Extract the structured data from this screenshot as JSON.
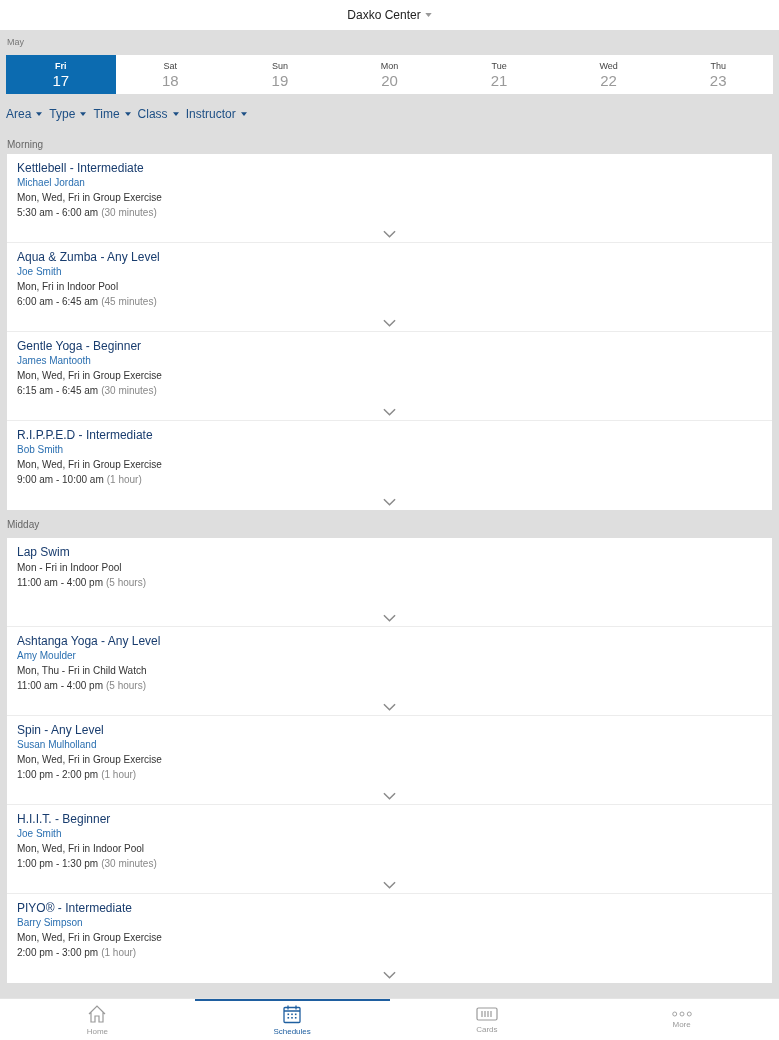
{
  "header": {
    "title": "Daxko Center"
  },
  "month": "May",
  "days": [
    {
      "weekday": "Fri",
      "date": "17",
      "selected": true
    },
    {
      "weekday": "Sat",
      "date": "18",
      "selected": false
    },
    {
      "weekday": "Sun",
      "date": "19",
      "selected": false
    },
    {
      "weekday": "Mon",
      "date": "20",
      "selected": false
    },
    {
      "weekday": "Tue",
      "date": "21",
      "selected": false
    },
    {
      "weekday": "Wed",
      "date": "22",
      "selected": false
    },
    {
      "weekday": "Thu",
      "date": "23",
      "selected": false
    }
  ],
  "filters": [
    "Area",
    "Type",
    "Time",
    "Class",
    "Instructor"
  ],
  "sections": [
    {
      "label": "Morning",
      "classes": [
        {
          "title": "Kettlebell - Intermediate",
          "instructor": "Michael Jordan",
          "schedule": "Mon, Wed, Fri in Group Exercise",
          "time": "5:30 am - 6:00 am",
          "duration": "(30 minutes)"
        },
        {
          "title": "Aqua & Zumba - Any Level",
          "instructor": "Joe Smith",
          "schedule": "Mon, Fri in Indoor Pool",
          "time": "6:00 am - 6:45 am",
          "duration": "(45 minutes)"
        },
        {
          "title": "Gentle Yoga - Beginner",
          "instructor": "James Mantooth",
          "schedule": "Mon, Wed, Fri in Group Exercise",
          "time": "6:15 am - 6:45 am",
          "duration": "(30 minutes)"
        },
        {
          "title": "R.I.P.P.E.D - Intermediate",
          "instructor": "Bob Smith",
          "schedule": "Mon, Wed, Fri in Group Exercise",
          "time": "9:00 am - 10:00 am",
          "duration": "(1 hour)"
        }
      ]
    },
    {
      "label": "Midday",
      "classes": [
        {
          "title": "Lap Swim",
          "schedule": "Mon - Fri in Indoor Pool",
          "time": "11:00 am - 4:00 pm",
          "duration": "(5 hours)"
        },
        {
          "title": "Ashtanga Yoga - Any Level",
          "instructor": "Amy Moulder",
          "schedule": "Mon, Thu - Fri in Child Watch",
          "time": "11:00 am - 4:00 pm",
          "duration": "(5 hours)"
        },
        {
          "title": "Spin - Any Level",
          "instructor": "Susan Mulholland",
          "schedule": "Mon, Wed, Fri in Group Exercise",
          "time": "1:00 pm - 2:00 pm",
          "duration": "(1 hour)"
        },
        {
          "title": "H.I.I.T. - Beginner",
          "instructor": "Joe Smith",
          "schedule": "Mon, Wed, Fri in Indoor Pool",
          "time": "1:00 pm - 1:30 pm",
          "duration": "(30 minutes)"
        },
        {
          "title": "PIYO®  - Intermediate",
          "instructor": "Barry Simpson",
          "schedule": "Mon, Wed, Fri in Group Exercise",
          "time": "2:00 pm - 3:00 pm",
          "duration": "(1 hour)"
        }
      ]
    }
  ],
  "tab_bar": [
    {
      "label": "Home",
      "selected": false
    },
    {
      "label": "Schedules",
      "selected": true
    },
    {
      "label": "Cards",
      "selected": false
    },
    {
      "label": "More",
      "selected": false
    }
  ]
}
